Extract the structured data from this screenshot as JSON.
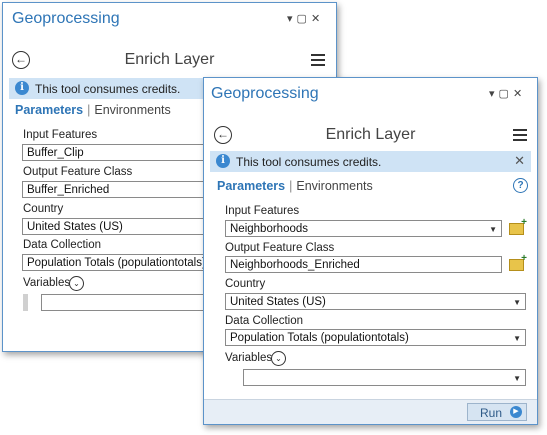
{
  "back_pane": {
    "title": "Geoprocessing",
    "window_controls": [
      "▾",
      "▢",
      "✕"
    ],
    "tool_title": "Enrich Layer",
    "banner": "This tool consumes credits.",
    "tab_parameters": "Parameters",
    "tab_environments": "Environments",
    "params": {
      "input_features_label": "Input Features",
      "input_features_value": "Buffer_Clip",
      "output_label": "Output Feature Class",
      "output_value": "Buffer_Enriched",
      "country_label": "Country",
      "country_value": "United States (US)",
      "collection_label": "Data Collection",
      "collection_value": "Population Totals (populationtotals)",
      "variables_label": "Variables"
    }
  },
  "front_pane": {
    "title": "Geoprocessing",
    "window_controls": [
      "▾",
      "▢",
      "✕"
    ],
    "tool_title": "Enrich Layer",
    "banner": "This tool consumes credits.",
    "tab_parameters": "Parameters",
    "tab_environments": "Environments",
    "params": {
      "input_features_label": "Input Features",
      "input_features_value": "Neighborhoods",
      "output_label": "Output Feature Class",
      "output_value": "Neighborhoods_Enriched",
      "country_label": "Country",
      "country_value": "United States (US)",
      "collection_label": "Data Collection",
      "collection_value": "Population Totals (populationtotals)",
      "variables_label": "Variables"
    },
    "run_label": "Run"
  },
  "icons": {
    "info": "i",
    "back": "←",
    "help": "?",
    "close": "✕",
    "dropdown": "▼",
    "expand": "⌄",
    "run": "▶"
  },
  "colors": {
    "accent": "#2e75b6",
    "banner_bg": "#cfe3f5",
    "border": "#5c93c9"
  }
}
